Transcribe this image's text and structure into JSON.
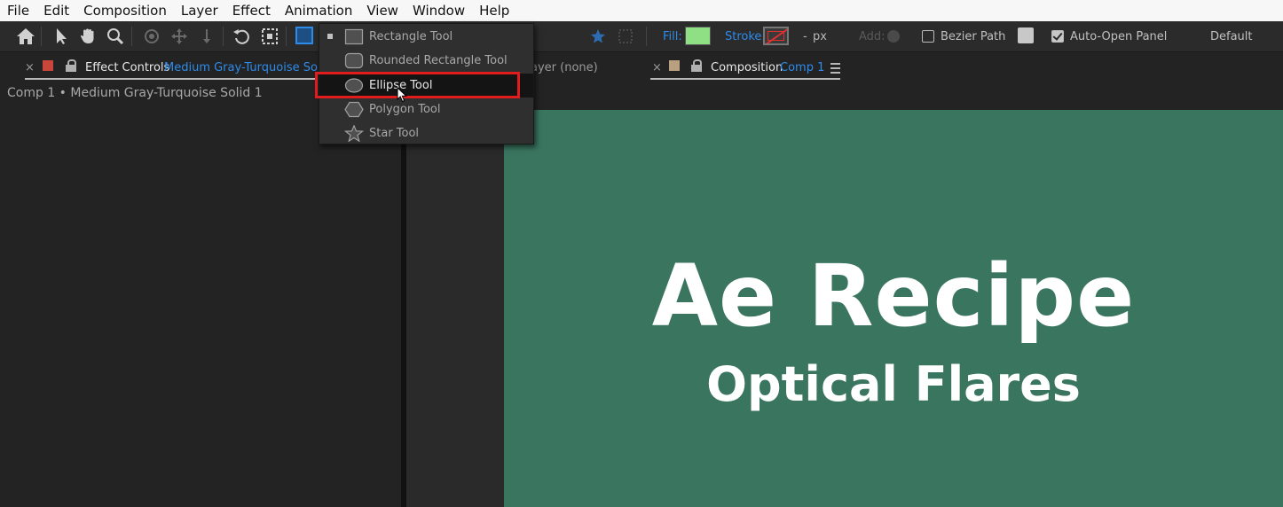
{
  "menubar": {
    "items": [
      "File",
      "Edit",
      "Composition",
      "Layer",
      "Effect",
      "Animation",
      "View",
      "Window",
      "Help"
    ]
  },
  "toolbar": {
    "icons": [
      "home-icon",
      "selection-arrow-icon",
      "hand-icon",
      "zoom-icon",
      "rotation-icon",
      "camera-orbit-icon",
      "pan-behind-icon",
      "undo-rotate-icon",
      "region-icon",
      "rectangle-shape-icon"
    ],
    "fill_label": "Fill:",
    "fill_color": "#8fe084",
    "stroke_label": "Stroke:",
    "stroke_width_dash": "-",
    "stroke_unit": "px",
    "add_label": "Add:",
    "bezier_label": "Bezier Path",
    "bezier_checked": false,
    "auto_open_label": "Auto-Open Panel",
    "auto_open_checked": true,
    "workspace_label": "Default"
  },
  "shape_menu": {
    "items": [
      {
        "label": "Rectangle Tool",
        "icon": "rectangle-icon",
        "selected": true,
        "highlighted": false
      },
      {
        "label": "Rounded Rectangle Tool",
        "icon": "rounded-rectangle-icon",
        "selected": false,
        "highlighted": false
      },
      {
        "label": "Ellipse Tool",
        "icon": "ellipse-icon",
        "selected": false,
        "highlighted": true
      },
      {
        "label": "Polygon Tool",
        "icon": "polygon-icon",
        "selected": false,
        "highlighted": false
      },
      {
        "label": "Star Tool",
        "icon": "star-icon",
        "selected": false,
        "highlighted": false
      }
    ]
  },
  "effect_panel": {
    "close": "×",
    "title": "Effect Controls",
    "layer_name": "Medium Gray-Turquoise Solid 1",
    "breadcrumb": "Comp 1 • Medium Gray-Turquoise Solid 1",
    "swatch_color": "#c9463d"
  },
  "layer_panel": {
    "title": "ayer (none)"
  },
  "comp_panel": {
    "close": "×",
    "title": "Composition",
    "comp_name": "Comp 1",
    "swatch_color": "#b8a080",
    "background_color": "#3a7560",
    "title_text": "Ae Recipe",
    "subtitle_text": "Optical Flares"
  }
}
